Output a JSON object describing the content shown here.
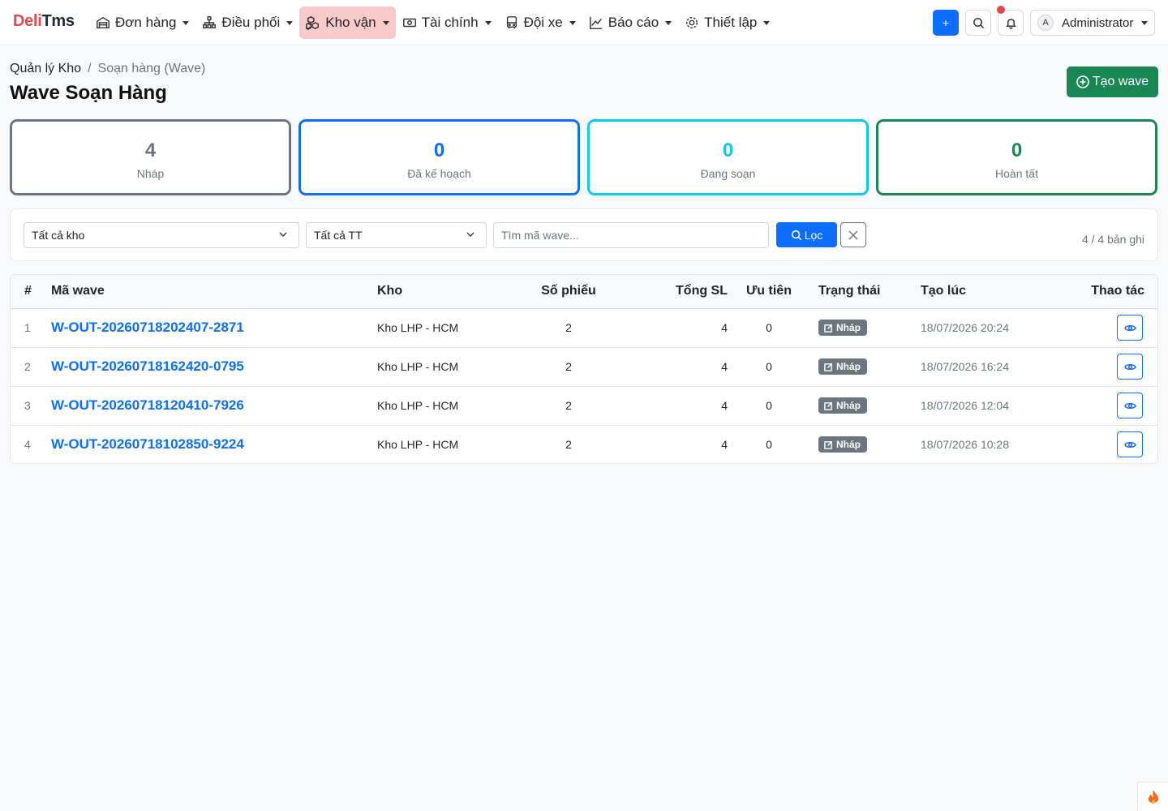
{
  "brand": {
    "part1": "Deli",
    "part2": "Tms"
  },
  "nav": [
    {
      "label": "Đơn hàng",
      "icon": "warehouse-icon"
    },
    {
      "label": "Điều phối",
      "icon": "network-icon"
    },
    {
      "label": "Kho vận",
      "icon": "boxes-icon",
      "active": true
    },
    {
      "label": "Tài chính",
      "icon": "cash-icon"
    },
    {
      "label": "Đội xe",
      "icon": "bus-icon"
    },
    {
      "label": "Báo cáo",
      "icon": "chart-icon"
    },
    {
      "label": "Thiết lập",
      "icon": "gear-icon"
    }
  ],
  "user": {
    "initial": "A",
    "name": "Administrator"
  },
  "breadcrumb": {
    "parent": "Quản lý Kho",
    "current": "Soạn hàng (Wave)"
  },
  "page_title": "Wave Soạn Hàng",
  "create_button": "Tạo wave",
  "stats": [
    {
      "value": "4",
      "label": "Nháp",
      "color": "#6c757d"
    },
    {
      "value": "0",
      "label": "Đã kế hoạch",
      "color": "#0d6efd"
    },
    {
      "value": "0",
      "label": "Đang soạn",
      "color": "#0dcaf0"
    },
    {
      "value": "0",
      "label": "Hoàn tất",
      "color": "#198754"
    }
  ],
  "filters": {
    "warehouse_selected": "Tất cả kho",
    "status_selected": "Tất cả TT",
    "search_placeholder": "Tìm mã wave...",
    "filter_button": "Lọc",
    "count_text": "4 / 4 bản ghi"
  },
  "table": {
    "headers": [
      "#",
      "Mã wave",
      "Kho",
      "Số phiếu",
      "Tổng SL",
      "Ưu tiên",
      "Trạng thái",
      "Tạo lúc",
      "Thao tác"
    ],
    "rows": [
      {
        "idx": "1",
        "code": "W-OUT-20260718202407-2871",
        "kho": "Kho LHP - HCM",
        "so_phieu": "2",
        "tong_sl": "4",
        "uu_tien": "0",
        "status": "Nháp",
        "created": "18/07/2026 20:24"
      },
      {
        "idx": "2",
        "code": "W-OUT-20260718162420-0795",
        "kho": "Kho LHP - HCM",
        "so_phieu": "2",
        "tong_sl": "4",
        "uu_tien": "0",
        "status": "Nháp",
        "created": "18/07/2026 16:24"
      },
      {
        "idx": "3",
        "code": "W-OUT-20260718120410-7926",
        "kho": "Kho LHP - HCM",
        "so_phieu": "2",
        "tong_sl": "4",
        "uu_tien": "0",
        "status": "Nháp",
        "created": "18/07/2026 12:04"
      },
      {
        "idx": "4",
        "code": "W-OUT-20260718102850-9224",
        "kho": "Kho LHP - HCM",
        "so_phieu": "2",
        "tong_sl": "4",
        "uu_tien": "0",
        "status": "Nháp",
        "created": "18/07/2026 10:28"
      }
    ]
  }
}
